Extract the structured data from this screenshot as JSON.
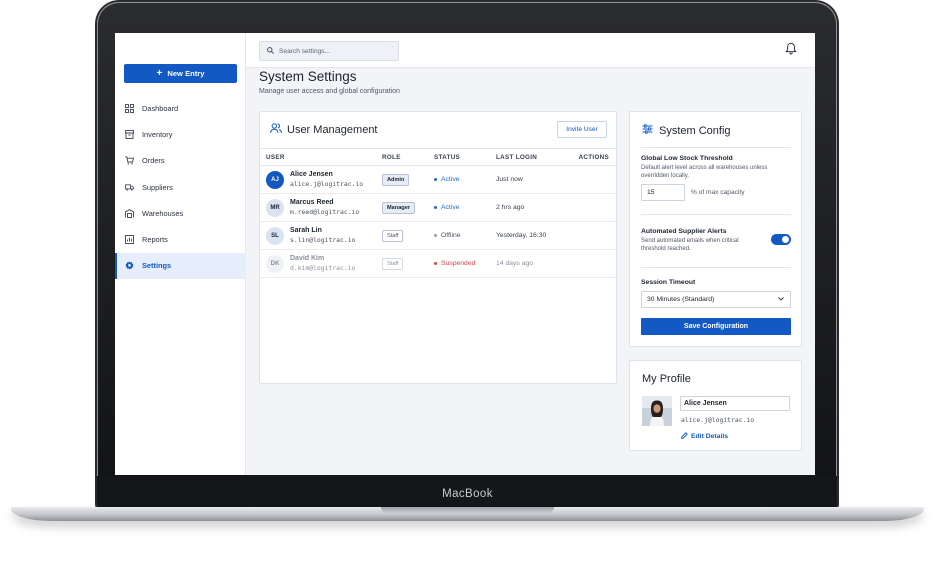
{
  "device": {
    "brand_label": "MacBook"
  },
  "sidebar": {
    "new_entry_label": "New Entry",
    "items": [
      {
        "label": "Dashboard",
        "icon": "grid-icon"
      },
      {
        "label": "Inventory",
        "icon": "archive-icon"
      },
      {
        "label": "Orders",
        "icon": "cart-icon"
      },
      {
        "label": "Suppliers",
        "icon": "truck-icon"
      },
      {
        "label": "Warehouses",
        "icon": "warehouse-icon"
      },
      {
        "label": "Reports",
        "icon": "report-icon"
      },
      {
        "label": "Settings",
        "icon": "gear-icon",
        "active": true
      }
    ]
  },
  "topbar": {
    "search_placeholder": "Search settings..."
  },
  "page": {
    "title": "System Settings",
    "subtitle": "Manage user access and global configuration"
  },
  "user_management": {
    "title": "User Management",
    "invite_label": "Invite User",
    "columns": [
      "USER",
      "ROLE",
      "STATUS",
      "LAST LOGIN",
      "ACTIONS"
    ],
    "rows": [
      {
        "initials": "AJ",
        "name": "Alice Jensen",
        "email": "alice.j@logitrac.io",
        "role": "Admin",
        "status": "Active",
        "last_login": "Just now"
      },
      {
        "initials": "MR",
        "name": "Marcus Reed",
        "email": "m.reed@logitrac.io",
        "role": "Manager",
        "status": "Active",
        "last_login": "2 hrs ago"
      },
      {
        "initials": "SL",
        "name": "Sarah Lin",
        "email": "s.lin@logitrac.io",
        "role": "Staff",
        "status": "Offline",
        "last_login": "Yesterday, 16:30"
      },
      {
        "initials": "DK",
        "name": "David Kim",
        "email": "d.kim@logitrac.io",
        "role": "Staff",
        "status": "Suspended",
        "last_login": "14 days ago"
      }
    ]
  },
  "system_config": {
    "title": "System Config",
    "stock_label": "Global Low Stock Threshold",
    "stock_help": "Default alert level across all warehouses unless overridden locally.",
    "stock_value": "15",
    "stock_unit": "% of max capacity",
    "alerts_label": "Automated Supplier Alerts",
    "alerts_help": "Send automated emails when critical threshold reached.",
    "alerts_enabled": true,
    "timeout_label": "Session Timeout",
    "timeout_value": "30 Minutes (Standard)",
    "save_label": "Save Configuration"
  },
  "profile": {
    "title": "My Profile",
    "name": "Alice Jensen",
    "email": "alice.j@logitrac.io",
    "edit_label": "Edit Details"
  },
  "colors": {
    "accent": "#1259c3",
    "active_status": "#1a6fc4",
    "offline_status": "#9aa0aa",
    "suspended_status": "#d64545"
  }
}
